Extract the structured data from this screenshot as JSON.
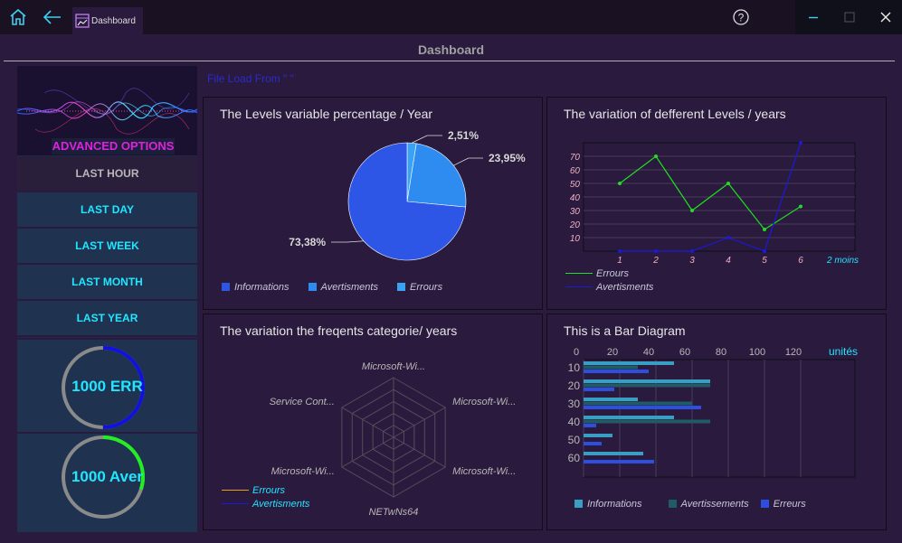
{
  "window": {
    "tab_label": "Dashboard"
  },
  "header": {
    "title": "Dashboard"
  },
  "sidebar": {
    "banner_label": "ADVANCED OPTIONS",
    "items": [
      {
        "label": "LAST HOUR"
      },
      {
        "label": "LAST DAY"
      },
      {
        "label": "LAST WEEK"
      },
      {
        "label": "LAST MONTH"
      },
      {
        "label": "LAST YEAR"
      }
    ],
    "gauges": [
      {
        "label": "1000 ERR",
        "value": 0.5,
        "color": "#1010e0"
      },
      {
        "label": "1000 Aver",
        "value": 0.3,
        "color": "#22ee22"
      }
    ]
  },
  "load_text": "File Load From \" \"",
  "panels": {
    "pie": {
      "title": "The Levels variable percentage / Year",
      "legend": [
        "Informations",
        "Avertisments",
        "Errours"
      ]
    },
    "line": {
      "title": "The variation of defferent Levels / years",
      "xlabel": "2 moins",
      "legend": [
        "Errours",
        "Avertisments"
      ]
    },
    "radar": {
      "title": "The variation the freqents categorie/ years",
      "axes": [
        "Microsoft-Wi...",
        "Microsoft-Wi...",
        "Microsoft-Wi...",
        "NETwNs64",
        "Microsoft-Wi...",
        "Service Cont..."
      ],
      "legend": [
        "Errours",
        "Avertisments"
      ]
    },
    "bar": {
      "title": "This is a Bar Diagram",
      "xlabel": "unités",
      "legend": [
        "Informations",
        "Avertissements",
        "Erreurs"
      ]
    }
  },
  "chart_data": [
    {
      "type": "pie",
      "title": "The Levels variable percentage / Year",
      "labels": [
        "Informations",
        "Avertisments",
        "Errours"
      ],
      "values": [
        73.38,
        23.95,
        2.51
      ],
      "value_labels": [
        "73,38%",
        "23,95%",
        "2,51%"
      ],
      "colors": [
        "#2d55e6",
        "#2e8cf0",
        "#3aa2f2"
      ]
    },
    {
      "type": "line",
      "title": "The variation of defferent Levels / years",
      "x": [
        1,
        2,
        3,
        4,
        5,
        6
      ],
      "xlabel": "2 moins",
      "ylim": [
        0,
        80
      ],
      "yticks": [
        10,
        20,
        30,
        40,
        50,
        60,
        70
      ],
      "series": [
        {
          "name": "Errours",
          "values": [
            50,
            70,
            30,
            50,
            16,
            33
          ],
          "color": "#22dd22"
        },
        {
          "name": "Avertisments",
          "values": [
            0,
            0,
            0,
            10,
            0,
            80
          ],
          "color": "#1a1ad8"
        }
      ]
    },
    {
      "type": "radar",
      "title": "The variation the freqents categorie/ years",
      "axes": [
        "Microsoft-Wi...",
        "Microsoft-Wi...",
        "Microsoft-Wi...",
        "NETwNs64",
        "Microsoft-Wi...",
        "Service Cont..."
      ],
      "series": [
        {
          "name": "Errours",
          "color": "#e0a020"
        },
        {
          "name": "Avertisments",
          "color": "#1a1ad8"
        }
      ]
    },
    {
      "type": "bar",
      "orientation": "horizontal",
      "title": "This is a Bar Diagram",
      "categories": [
        "10",
        "20",
        "30",
        "40",
        "50",
        "60"
      ],
      "xlabel": "unités",
      "xlim": [
        0,
        150
      ],
      "xticks": [
        0,
        20,
        40,
        60,
        80,
        100,
        120
      ],
      "series": [
        {
          "name": "Informations",
          "values": [
            50,
            70,
            30,
            50,
            16,
            33
          ],
          "color": "#3a9ec4"
        },
        {
          "name": "Avertissements",
          "values": [
            30,
            70,
            60,
            70,
            0,
            0
          ],
          "color": "#1f5c68"
        },
        {
          "name": "Erreurs",
          "values": [
            36,
            17,
            65,
            7,
            10,
            39
          ],
          "color": "#2d4fe0"
        }
      ]
    }
  ]
}
